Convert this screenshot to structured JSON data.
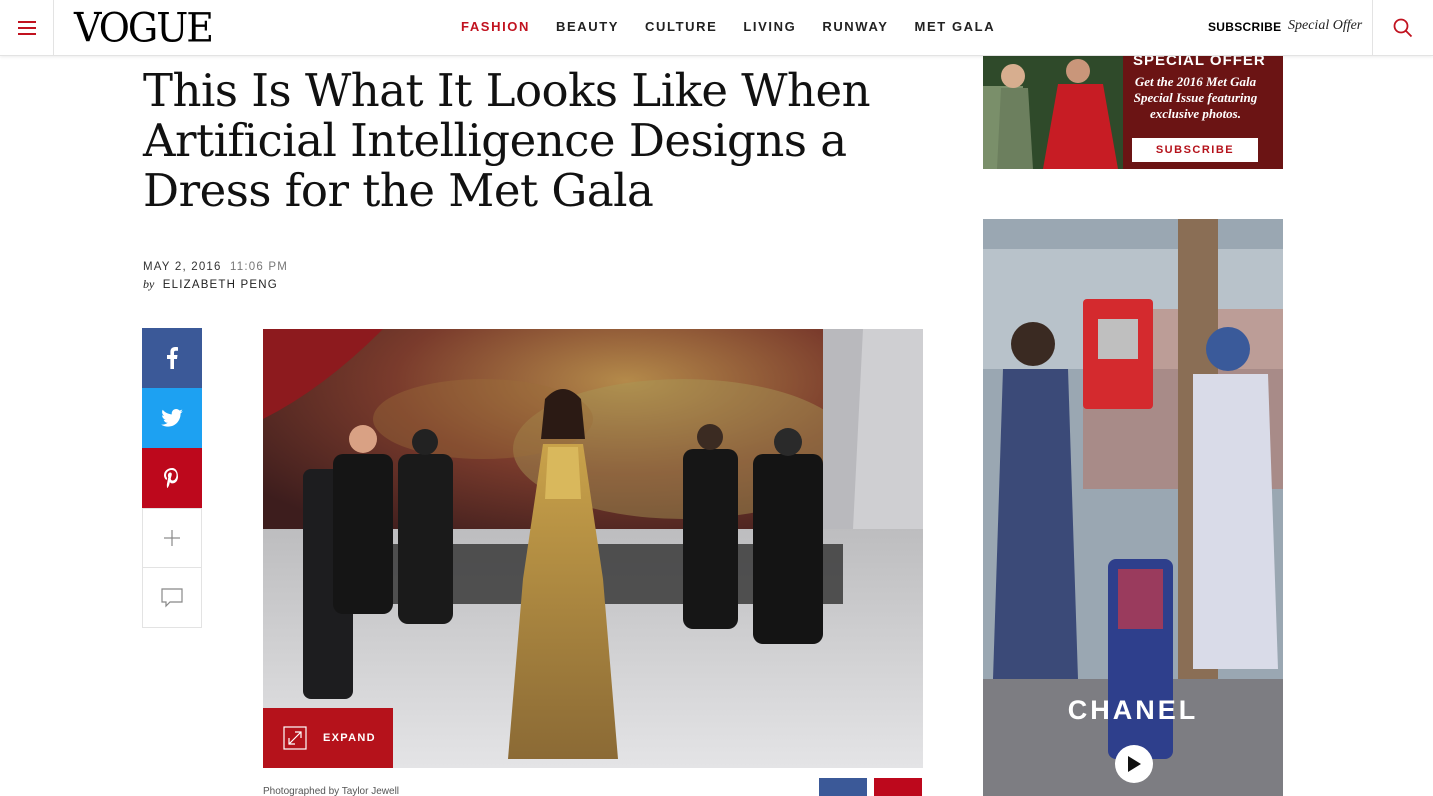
{
  "header": {
    "logo": "VOGUE",
    "nav": [
      {
        "label": "FASHION",
        "active": true
      },
      {
        "label": "BEAUTY",
        "active": false
      },
      {
        "label": "CULTURE",
        "active": false
      },
      {
        "label": "LIVING",
        "active": false
      },
      {
        "label": "RUNWAY",
        "active": false
      },
      {
        "label": "MET GALA",
        "active": false
      }
    ],
    "subscribe": "SUBSCRIBE",
    "special_offer": "Special Offer",
    "menu_icon": "hamburger-icon",
    "search_icon": "search-icon"
  },
  "article": {
    "headline": "This Is What It Looks Like When Artificial Intelligence Designs a Dress for the Met Gala",
    "date": "MAY 2, 2016",
    "time": "11:06 PM",
    "by": "by",
    "author": "ELIZABETH PENG",
    "expand_label": "EXPAND",
    "photo_credit": "Photographed by Taylor Jewell"
  },
  "share": {
    "facebook_icon": "facebook-icon",
    "twitter_icon": "twitter-icon",
    "pinterest_icon": "pinterest-icon",
    "more_icon": "plus-icon",
    "comment_icon": "comment-icon"
  },
  "ads": {
    "top": {
      "title": "SPECIAL OFFER",
      "text": "Get the 2016 Met Gala Special Issue featuring exclusive photos.",
      "button": "SUBSCRIBE"
    },
    "chanel": {
      "brand": "CHANEL"
    }
  },
  "colors": {
    "accent": "#c1121f",
    "facebook": "#3b5998",
    "twitter": "#1da1f2",
    "pinterest": "#bd081c"
  }
}
